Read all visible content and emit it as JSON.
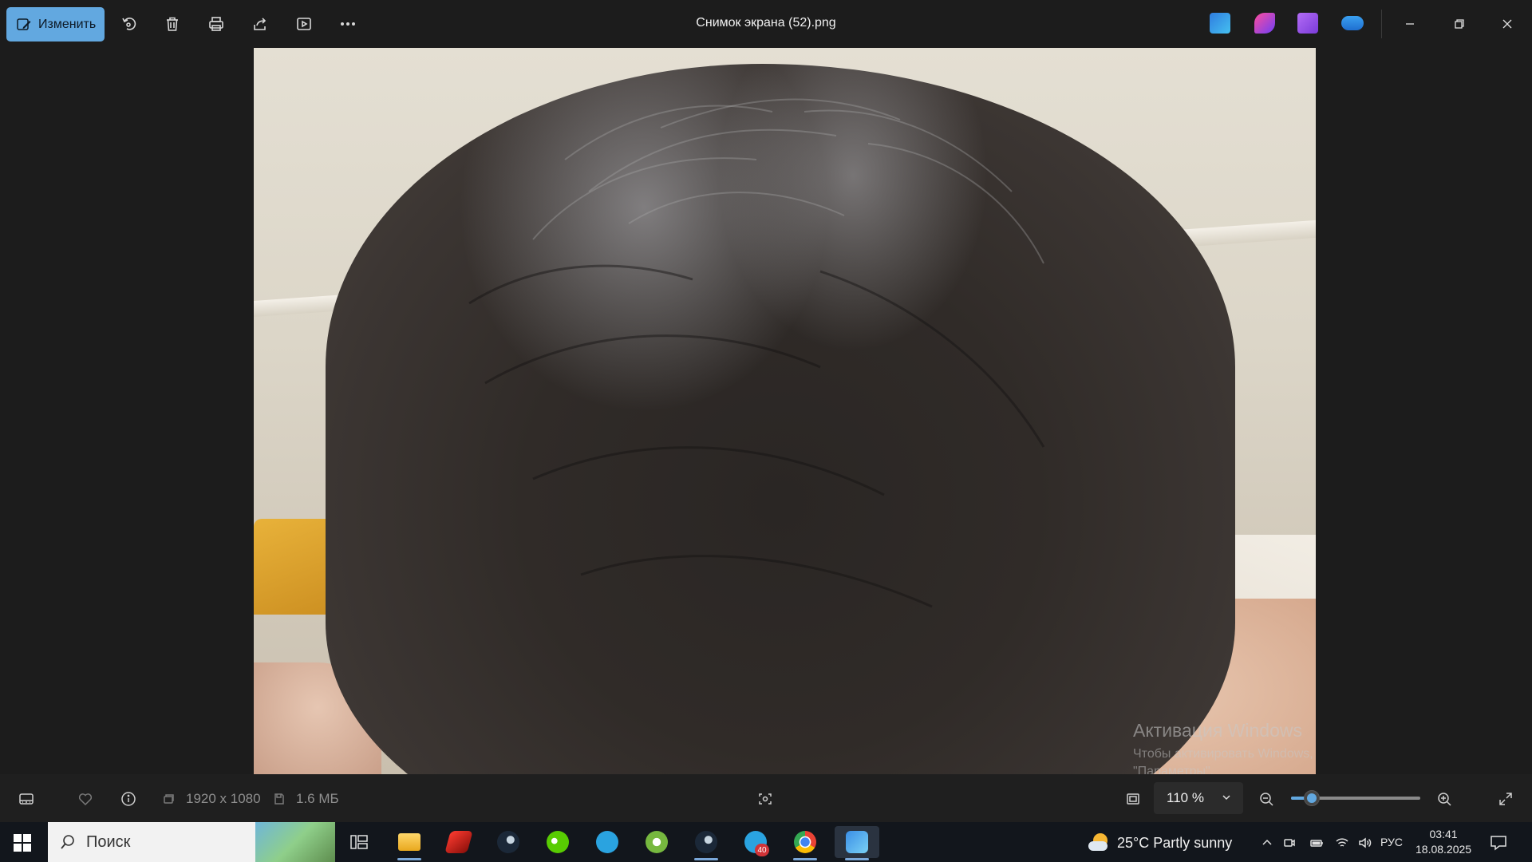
{
  "toolbar": {
    "edit_label": "Изменить",
    "title": "Снимок экрана (52).png",
    "icons": [
      "rotate-icon",
      "delete-icon",
      "print-icon",
      "share-icon",
      "slideshow-icon",
      "more-icon"
    ],
    "app_icons": [
      "designer-icon",
      "clipchamp-icon",
      "video-editor-icon",
      "onedrive-icon"
    ]
  },
  "watermark": {
    "line1": "Активация Windows",
    "line2": "Чтобы активировать Windows, перейдите в раздел",
    "line3": "\"Параметры\"."
  },
  "infobar": {
    "dimensions": "1920 x 1080",
    "filesize": "1.6 МБ",
    "zoom": "110 %",
    "zoom_level": 0.16
  },
  "taskbar": {
    "search_placeholder": "Поиск",
    "apps": [
      "task-view",
      "file-explorer",
      "app-red",
      "steam",
      "duolingo",
      "telegram",
      "utorrent",
      "steam-2",
      "telegram-2",
      "chrome",
      "photos"
    ],
    "telegram_badge": "40",
    "weather": "25°C  Partly sunny",
    "language": "РУС",
    "time": "03:41",
    "date": "18.08.2025"
  }
}
